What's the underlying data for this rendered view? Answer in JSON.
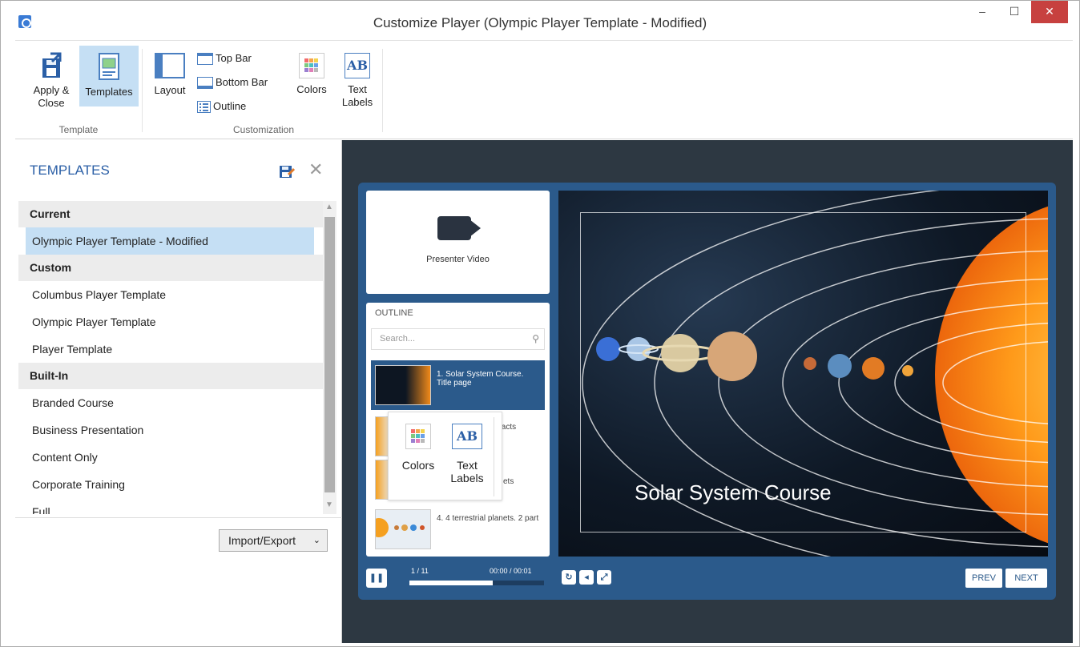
{
  "window": {
    "title": "Customize Player (Olympic Player Template - Modified)",
    "minimize": "–",
    "maximize": "☐",
    "close": "✕"
  },
  "ribbon": {
    "apply_close": "Apply & Close",
    "templates": "Templates",
    "layout": "Layout",
    "top_bar": "Top Bar",
    "bottom_bar": "Bottom Bar",
    "outline": "Outline",
    "colors": "Colors",
    "text_labels": "Text Labels",
    "text_labels_icon": "AB",
    "group_template": "Template",
    "group_customization": "Customization"
  },
  "templates_panel": {
    "title": "TEMPLATES",
    "sections": [
      {
        "heading": "Current",
        "items": [
          "Olympic Player Template - Modified"
        ]
      },
      {
        "heading": "Custom",
        "items": [
          "Columbus Player Template",
          "Olympic Player Template",
          "Player Template"
        ]
      },
      {
        "heading": "Built-In",
        "items": [
          "Branded Course",
          "Business Presentation",
          "Content Only",
          "Corporate Training",
          "Full"
        ]
      }
    ],
    "selected_item": "Olympic Player Template - Modified",
    "import_export": "Import/Export"
  },
  "preview": {
    "presenter_video": "Presenter Video",
    "outline_title": "OUTLINE",
    "search_placeholder": "Search...",
    "outline_items": [
      {
        "label": "1. Solar System Course. Title page",
        "active": true
      },
      {
        "label": "facts",
        "active": false
      },
      {
        "label": "ets",
        "active": false
      },
      {
        "label": "4. 4 terrestrial planets. 2 part",
        "active": false
      }
    ],
    "slide_title": "Solar System Course",
    "slide_counter": "1 / 11",
    "time": "00:00 / 00:01",
    "progress": 0.62,
    "prev": "PREV",
    "next": "NEXT"
  },
  "popup": {
    "colors": "Colors",
    "text_labels": "Text Labels",
    "text_labels_icon": "AB"
  },
  "colors": {
    "accent": "#2b5fa6",
    "selected_bg": "#c5dff4",
    "player_blue": "#2b5a8b",
    "preview_bg": "#2d3842",
    "close_red": "#c7413f"
  }
}
